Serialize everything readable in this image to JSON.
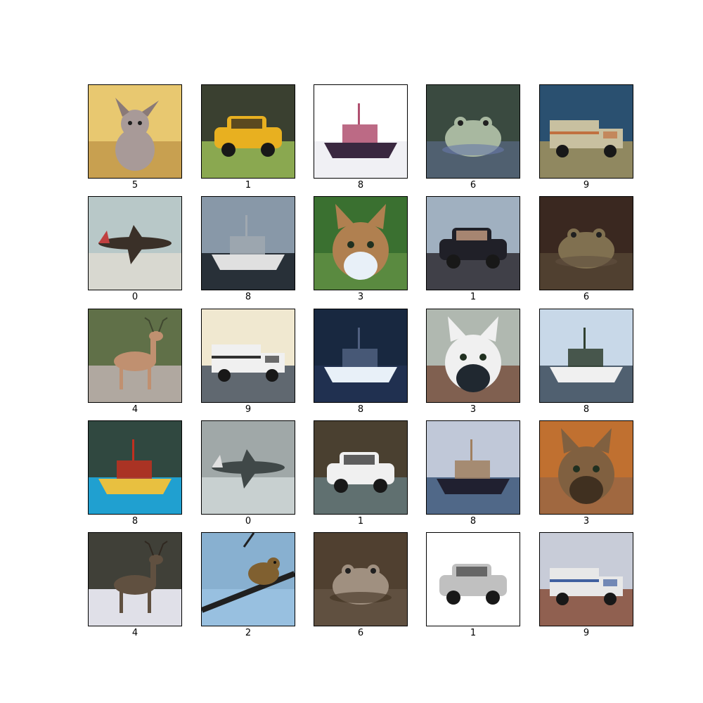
{
  "grid": {
    "rows": 5,
    "cols": 5,
    "images": [
      {
        "label": "5",
        "subject": "dog",
        "colors": {
          "sky": "#e8c870",
          "ground": "#c8a050",
          "object": "#a89a98",
          "accent": "#8a7a78"
        }
      },
      {
        "label": "1",
        "subject": "automobile",
        "colors": {
          "sky": "#3a4030",
          "ground": "#8aa850",
          "object": "#e8b020",
          "accent": "#202020"
        }
      },
      {
        "label": "8",
        "subject": "ship",
        "colors": {
          "sky": "#ffffff",
          "ground": "#f0f0f4",
          "object": "#3a2840",
          "accent": "#b05070"
        }
      },
      {
        "label": "6",
        "subject": "frog",
        "colors": {
          "sky": "#3a4a40",
          "ground": "#506070",
          "object": "#a8b8a0",
          "accent": "#6878a8"
        }
      },
      {
        "label": "9",
        "subject": "truck",
        "colors": {
          "sky": "#2a5070",
          "ground": "#908860",
          "object": "#c8c0a0",
          "accent": "#c07040"
        }
      },
      {
        "label": "0",
        "subject": "airplane",
        "colors": {
          "sky": "#b8c8c8",
          "ground": "#d8d8d0",
          "object": "#3a3028",
          "accent": "#c04040"
        }
      },
      {
        "label": "8",
        "subject": "ship",
        "colors": {
          "sky": "#8898a8",
          "ground": "#283038",
          "object": "#e0e0e0",
          "accent": "#a0a8b0"
        }
      },
      {
        "label": "3",
        "subject": "cat",
        "colors": {
          "sky": "#3a7030",
          "ground": "#5a8a40",
          "object": "#b08050",
          "accent": "#e8f0f8"
        }
      },
      {
        "label": "1",
        "subject": "automobile",
        "colors": {
          "sky": "#a0b0c0",
          "ground": "#404048",
          "object": "#202028",
          "accent": "#e0b090"
        }
      },
      {
        "label": "6",
        "subject": "frog",
        "colors": {
          "sky": "#3a2820",
          "ground": "#504030",
          "object": "#807050",
          "accent": "#605040"
        }
      },
      {
        "label": "4",
        "subject": "deer",
        "colors": {
          "sky": "#607048",
          "ground": "#b0a8a0",
          "object": "#c09070",
          "accent": "#404830"
        }
      },
      {
        "label": "9",
        "subject": "truck",
        "colors": {
          "sky": "#f0e8d0",
          "ground": "#606870",
          "object": "#f0f0f0",
          "accent": "#303030"
        }
      },
      {
        "label": "8",
        "subject": "ship",
        "colors": {
          "sky": "#182840",
          "ground": "#203050",
          "object": "#e8f0f8",
          "accent": "#506080"
        }
      },
      {
        "label": "3",
        "subject": "cat",
        "colors": {
          "sky": "#b0b8b0",
          "ground": "#806050",
          "object": "#f0f0f0",
          "accent": "#202830"
        }
      },
      {
        "label": "8",
        "subject": "ship",
        "colors": {
          "sky": "#c8d8e8",
          "ground": "#506070",
          "object": "#f0f0f0",
          "accent": "#304030"
        }
      },
      {
        "label": "8",
        "subject": "ship",
        "colors": {
          "sky": "#304840",
          "ground": "#20a0d0",
          "object": "#e8c040",
          "accent": "#c03020"
        }
      },
      {
        "label": "0",
        "subject": "airplane",
        "colors": {
          "sky": "#a0a8a8",
          "ground": "#c8d0d0",
          "object": "#404848",
          "accent": "#e0e0e0"
        }
      },
      {
        "label": "1",
        "subject": "automobile",
        "colors": {
          "sky": "#4a4030",
          "ground": "#607070",
          "object": "#f0f0f0",
          "accent": "#202020"
        }
      },
      {
        "label": "8",
        "subject": "ship",
        "colors": {
          "sky": "#c0c8d8",
          "ground": "#506888",
          "object": "#202030",
          "accent": "#a08060"
        }
      },
      {
        "label": "3",
        "subject": "cat",
        "colors": {
          "sky": "#c07030",
          "ground": "#a06840",
          "object": "#806040",
          "accent": "#403020"
        }
      },
      {
        "label": "4",
        "subject": "deer",
        "colors": {
          "sky": "#404038",
          "ground": "#e0e0e8",
          "object": "#605040",
          "accent": "#302820"
        }
      },
      {
        "label": "2",
        "subject": "bird",
        "colors": {
          "sky": "#88b0d0",
          "ground": "#98c0e0",
          "object": "#806030",
          "accent": "#202020"
        }
      },
      {
        "label": "6",
        "subject": "frog",
        "colors": {
          "sky": "#504030",
          "ground": "#605040",
          "object": "#a09080",
          "accent": "#403020"
        }
      },
      {
        "label": "1",
        "subject": "automobile",
        "colors": {
          "sky": "#ffffff",
          "ground": "#ffffff",
          "object": "#c0c0c0",
          "accent": "#404040"
        }
      },
      {
        "label": "9",
        "subject": "truck",
        "colors": {
          "sky": "#c8ccd8",
          "ground": "#906050",
          "object": "#e8e8e8",
          "accent": "#4060a0"
        }
      }
    ]
  }
}
